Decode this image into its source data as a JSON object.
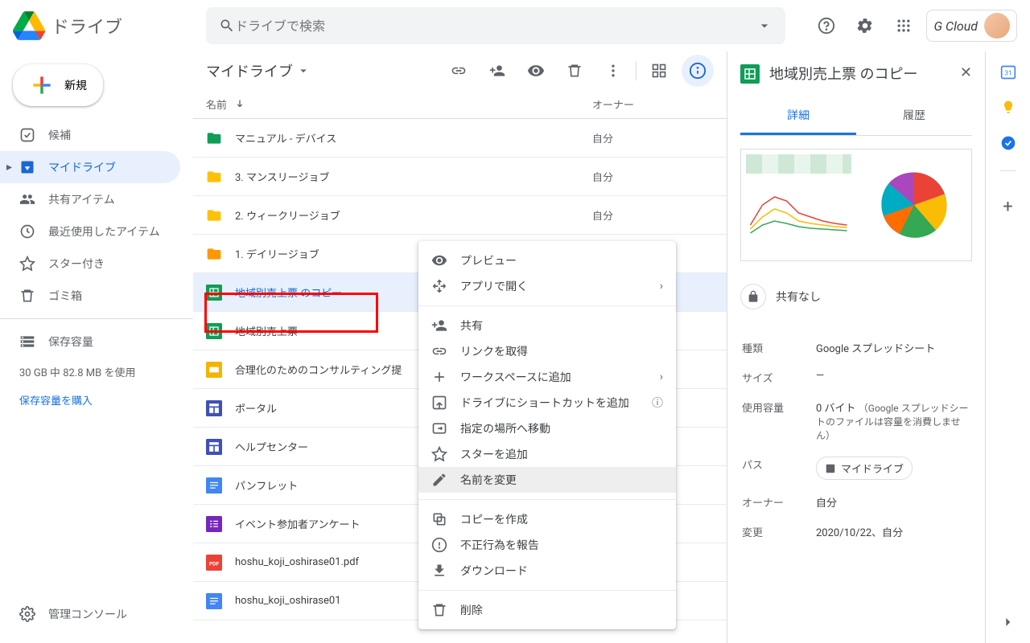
{
  "header": {
    "app_name": "ドライブ",
    "search_placeholder": "ドライブで検索",
    "account_label": "G Cloud"
  },
  "sidebar": {
    "new_button": "新規",
    "items": [
      {
        "label": "候補"
      },
      {
        "label": "マイドライブ"
      },
      {
        "label": "共有アイテム"
      },
      {
        "label": "最近使用したアイテム"
      },
      {
        "label": "スター付き"
      },
      {
        "label": "ゴミ箱"
      }
    ],
    "storage_label": "保存容量",
    "storage_usage": "30 GB 中 82.8 MB を使用",
    "buy_storage": "保存容量を購入",
    "admin_console": "管理コンソール"
  },
  "content": {
    "location": "マイドライブ",
    "columns": {
      "name": "名前",
      "owner": "オーナー"
    },
    "files": [
      {
        "name": "マニュアル - デバイス",
        "owner": "自分",
        "icon": "folder-green"
      },
      {
        "name": "3. マンスリージョブ",
        "owner": "自分",
        "icon": "folder-yellow"
      },
      {
        "name": "2. ウィークリージョブ",
        "owner": "自分",
        "icon": "folder-yellow"
      },
      {
        "name": "1. デイリージョブ",
        "owner": "自分",
        "icon": "folder-orange"
      },
      {
        "name": "地域別売上票 のコピー",
        "owner": "",
        "icon": "sheets",
        "selected": true
      },
      {
        "name": "地域別売上票",
        "owner": "",
        "icon": "sheets"
      },
      {
        "name": "合理化のためのコンサルティング提",
        "owner": "",
        "icon": "slides"
      },
      {
        "name": "ポータル",
        "owner": "",
        "icon": "sites"
      },
      {
        "name": "ヘルプセンター",
        "owner": "",
        "icon": "sites"
      },
      {
        "name": "パンフレット",
        "owner": "",
        "icon": "docs"
      },
      {
        "name": "イベント参加者アンケート",
        "owner": "",
        "icon": "forms"
      },
      {
        "name": "hoshu_koji_oshirase01.pdf",
        "owner": "",
        "icon": "pdf"
      },
      {
        "name": "hoshu_koji_oshirase01",
        "owner": "",
        "icon": "docs"
      }
    ]
  },
  "context_menu": {
    "items": [
      {
        "label": "プレビュー",
        "icon": "eye"
      },
      {
        "label": "アプリで開く",
        "icon": "open-with",
        "arrow": true
      },
      {
        "divider": true
      },
      {
        "label": "共有",
        "icon": "person-add"
      },
      {
        "label": "リンクを取得",
        "icon": "link"
      },
      {
        "label": "ワークスペースに追加",
        "icon": "plus",
        "arrow": true
      },
      {
        "label": "ドライブにショートカットを追加",
        "icon": "shortcut",
        "help": true
      },
      {
        "label": "指定の場所へ移動",
        "icon": "move"
      },
      {
        "label": "スターを追加",
        "icon": "star"
      },
      {
        "label": "名前を変更",
        "icon": "pencil",
        "hovered": true
      },
      {
        "divider": true
      },
      {
        "label": "コピーを作成",
        "icon": "copy"
      },
      {
        "label": "不正行為を報告",
        "icon": "report"
      },
      {
        "label": "ダウンロード",
        "icon": "download"
      },
      {
        "divider": true
      },
      {
        "label": "削除",
        "icon": "trash"
      }
    ]
  },
  "details": {
    "title": "地域別売上票 のコピー",
    "tabs": {
      "details": "詳細",
      "activity": "履歴"
    },
    "share_status": "共有なし",
    "props": {
      "type_label": "種類",
      "type_value": "Google スプレッドシート",
      "size_label": "サイズ",
      "size_value": "—",
      "usage_label": "使用容量",
      "usage_value": "0 バイト",
      "usage_note": "（Google スプレッドシートのファイルは容量を消費しません）",
      "path_label": "パス",
      "path_value": "マイドライブ",
      "owner_label": "オーナー",
      "owner_value": "自分",
      "modified_label": "変更",
      "modified_value": "2020/10/22、自分"
    }
  }
}
